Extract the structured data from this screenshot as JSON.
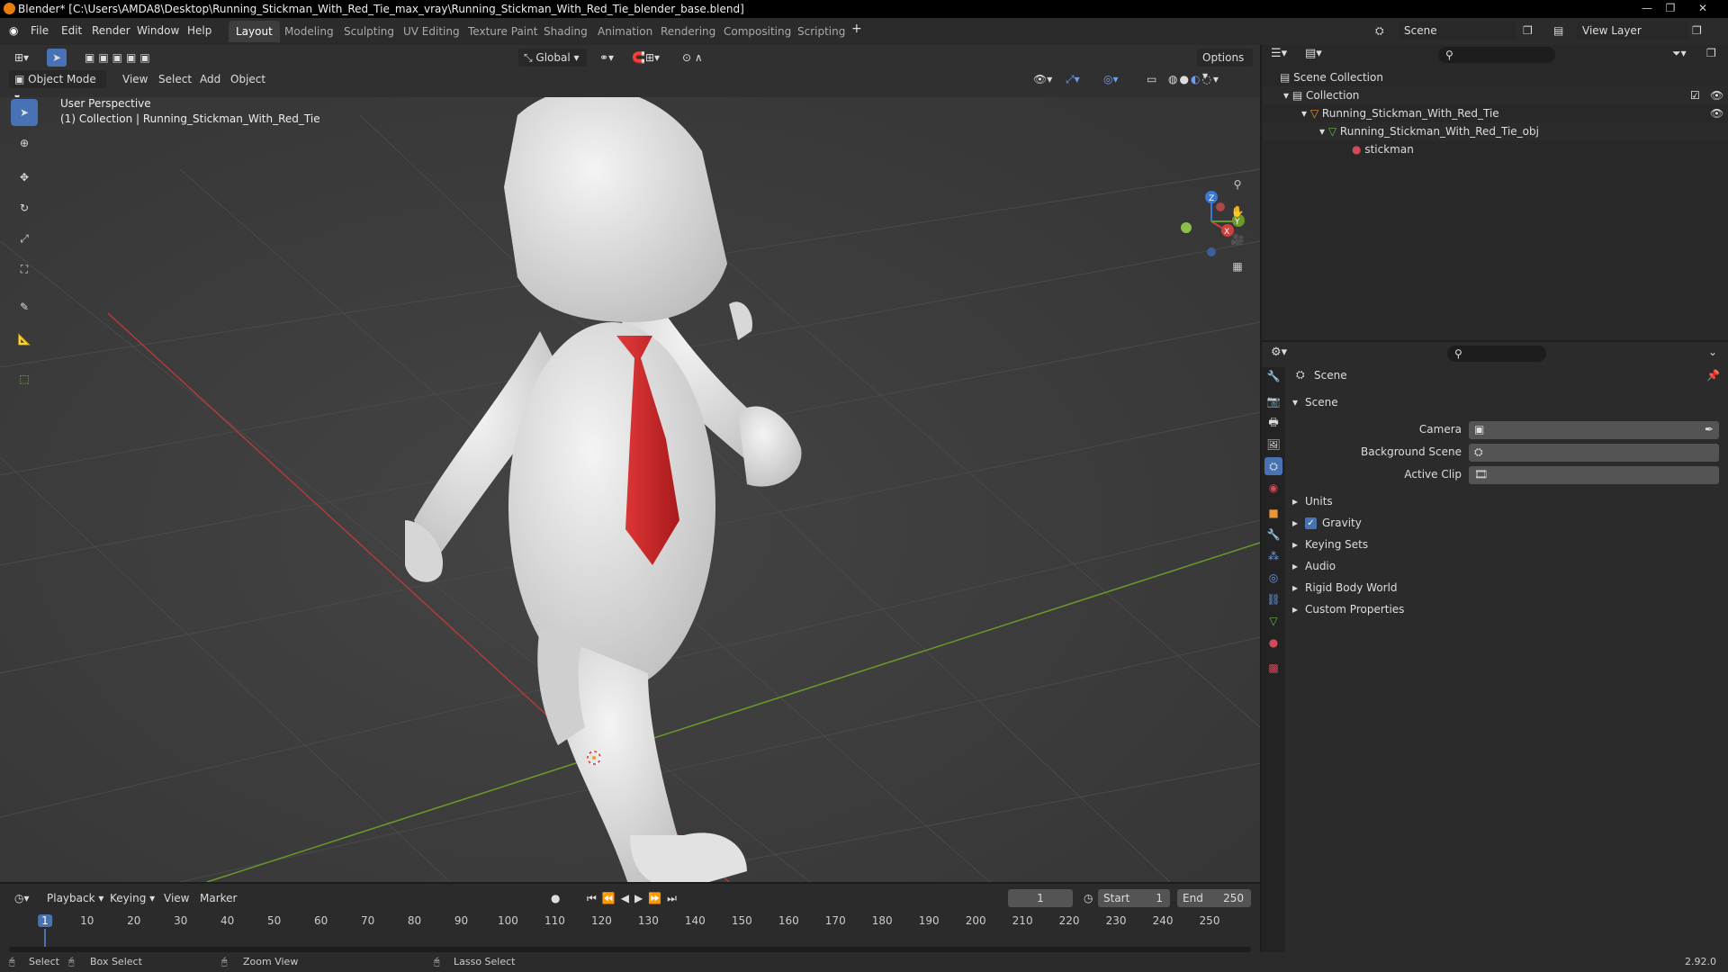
{
  "window": {
    "title": "Blender* [C:\\Users\\AMDA8\\Desktop\\Running_Stickman_With_Red_Tie_max_vray\\Running_Stickman_With_Red_Tie_blender_base.blend]"
  },
  "menu": [
    "File",
    "Edit",
    "Render",
    "Window",
    "Help"
  ],
  "workspaces": [
    "Layout",
    "Modeling",
    "Sculpting",
    "UV Editing",
    "Texture Paint",
    "Shading",
    "Animation",
    "Rendering",
    "Compositing",
    "Scripting"
  ],
  "scene_name": "Scene",
  "view_layer": "View Layer",
  "viewport": {
    "mode": "Object Mode",
    "menus": [
      "View",
      "Select",
      "Add",
      "Object"
    ],
    "transform": "Global",
    "options": "Options",
    "perspective": "User Perspective",
    "collection_info": "(1) Collection | Running_Stickman_With_Red_Tie"
  },
  "outliner": {
    "root": "Scene Collection",
    "collection": "Collection",
    "object": "Running_Stickman_With_Red_Tie",
    "mesh": "Running_Stickman_With_Red_Tie_obj",
    "material": "stickman"
  },
  "properties": {
    "header": "Scene",
    "section": "Scene",
    "camera_label": "Camera",
    "bg_scene_label": "Background Scene",
    "active_clip_label": "Active Clip",
    "panels": [
      "Units",
      "Gravity",
      "Keying Sets",
      "Audio",
      "Rigid Body World",
      "Custom Properties"
    ],
    "gravity_checked": true
  },
  "timeline": {
    "menus": [
      "Playback",
      "Keying",
      "View",
      "Marker"
    ],
    "current_frame": "1",
    "start_label": "Start",
    "start": "1",
    "end_label": "End",
    "end": "250",
    "ticks": [
      "1",
      "10",
      "20",
      "30",
      "40",
      "50",
      "60",
      "70",
      "80",
      "90",
      "100",
      "110",
      "120",
      "130",
      "140",
      "150",
      "160",
      "170",
      "180",
      "190",
      "200",
      "210",
      "220",
      "230",
      "240",
      "250"
    ]
  },
  "statusbar": {
    "select": "Select",
    "box_select": "Box Select",
    "zoom_view": "Zoom View",
    "lasso_select": "Lasso Select",
    "version": "2.92.0"
  },
  "colors": {
    "accent": "#4772b3",
    "x_axis": "#b03b3b",
    "y_axis": "#6a9b2a",
    "z_axis": "#3a78d6",
    "tie": "#cc2426"
  }
}
